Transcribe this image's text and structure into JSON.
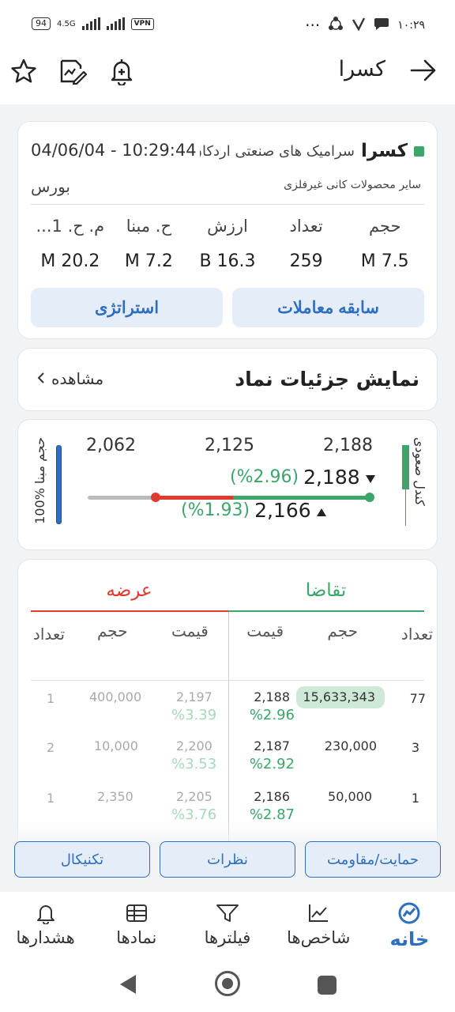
{
  "status_bar": {
    "battery": "94",
    "network": "4.5G",
    "vpn": "VPN",
    "time": "۱۰:۲۹",
    "dots": "···"
  },
  "header": {
    "title": "کسرا",
    "icons": [
      "star-icon",
      "edit-chart-icon",
      "add-alert-icon",
      "arrow-right-icon"
    ]
  },
  "symbol_card": {
    "symbol": "کسرا",
    "company": "سرامیک های صنعتی اردکان",
    "datetime": "04/06/04 - 10:29:44",
    "market": "بورس",
    "industry": "سایر محصولات کانی غیرفلزی",
    "stats": [
      {
        "label": "حجم",
        "value": "7.5 M"
      },
      {
        "label": "تعداد",
        "value": "259"
      },
      {
        "label": "ارزش",
        "value": "16.3 B"
      },
      {
        "label": "ح. مبنا",
        "value": "7.2 M"
      },
      {
        "label": "م. ح. 1...",
        "value": "20.2 M"
      }
    ],
    "buttons": {
      "history": "سابقه معاملات",
      "strategy": "استراتژی"
    }
  },
  "details_card": {
    "title": "نمایش جزئیات نماد",
    "link": "مشاهده"
  },
  "price_card": {
    "candle_label": "کندل صعودی",
    "volume_label": "100% حجم مبنا",
    "scale": [
      "2,188",
      "2,125",
      "2,062"
    ],
    "last_price": "2,188",
    "last_pct": "(%2.96)",
    "close_price": "2,166",
    "close_pct": "(%1.93)"
  },
  "order_book": {
    "buy_label": "تقاضا",
    "sell_label": "عرضه",
    "headers": {
      "count": "تعداد",
      "volume": "حجم",
      "price": "قیمت"
    },
    "buy": [
      {
        "count": "77",
        "volume": "15,633,343",
        "price": "2,188",
        "pct": "%2.96"
      },
      {
        "count": "3",
        "volume": "230,000",
        "price": "2,187",
        "pct": "%2.92"
      },
      {
        "count": "1",
        "volume": "50,000",
        "price": "2,186",
        "pct": "%2.87"
      }
    ],
    "sell": [
      {
        "count": "1",
        "volume": "400,000",
        "price": "2,197",
        "pct": "%3.39"
      },
      {
        "count": "2",
        "volume": "10,000",
        "price": "2,200",
        "pct": "%3.53"
      },
      {
        "count": "1",
        "volume": "2,350",
        "price": "2,205",
        "pct": "%3.76"
      }
    ]
  },
  "chips": [
    "حمایت/مقاومت",
    "نظرات",
    "تکنیکال"
  ],
  "bottom_nav": [
    {
      "label": "خانه",
      "icon": "home-icon"
    },
    {
      "label": "شاخص‌ها",
      "icon": "index-chart-icon"
    },
    {
      "label": "فیلترها",
      "icon": "filter-icon"
    },
    {
      "label": "نمادها",
      "icon": "symbols-icon"
    },
    {
      "label": "هشدارها",
      "icon": "bell-icon"
    }
  ]
}
